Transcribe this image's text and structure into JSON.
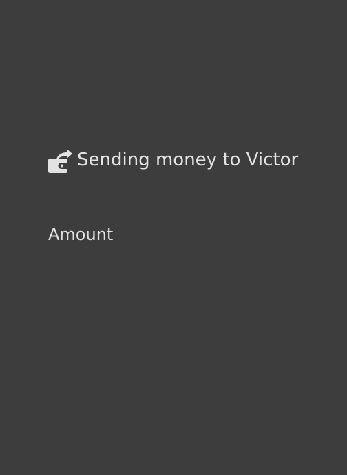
{
  "screen": {
    "background_color": "#3d3d3d",
    "text_color": "#e1e1e1"
  },
  "header": {
    "icon": "wallet-send-icon",
    "title": "Sending money to Victor"
  },
  "form": {
    "amount_label": "Amount"
  }
}
